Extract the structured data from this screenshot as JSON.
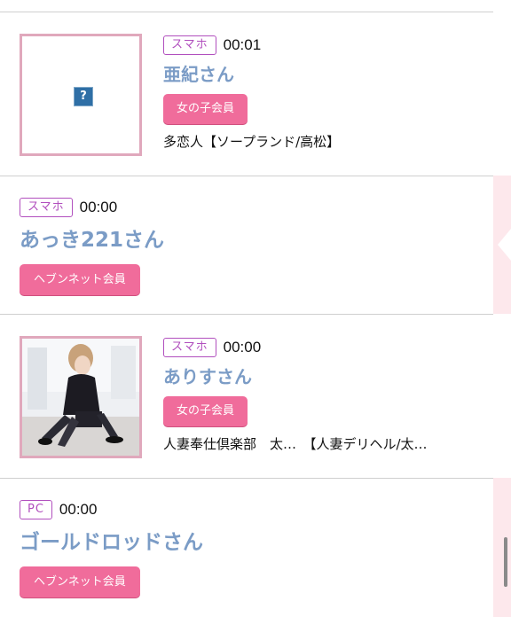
{
  "entries": [
    {
      "device": "スマホ",
      "time": "00:01",
      "name": "亜紀さん",
      "member": "女の子会員",
      "shop": "多恋人【ソープランド/高松】",
      "photo_icon": "broken-image-icon",
      "photo_placeholder_text": "?"
    },
    {
      "device": "スマホ",
      "time": "00:00",
      "name": "あっき221さん",
      "member": "ヘブンネット会員"
    },
    {
      "device": "スマホ",
      "time": "00:00",
      "name": "ありすさん",
      "member": "女の子会員",
      "shop": "人妻奉仕倶楽部　太…　【人妻デリヘル/太…",
      "photo_icon": "profile-photo"
    },
    {
      "device": "PC",
      "time": "00:00",
      "name": "ゴールドロッドさん",
      "member": "ヘブンネット会員"
    }
  ],
  "colors": {
    "device_badge": "#b14fbe",
    "name": "#7b9cc6",
    "member_badge": "#f06c9b",
    "thumb_border": "#e0a8bc",
    "side_strip": "#fde8ec"
  }
}
